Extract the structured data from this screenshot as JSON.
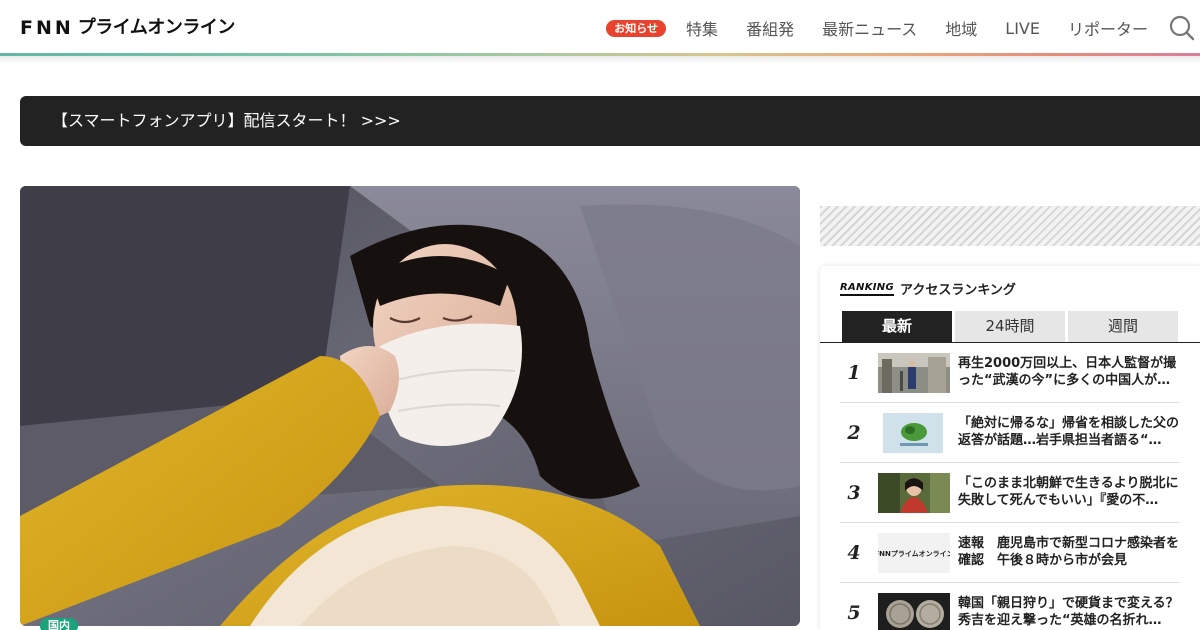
{
  "header": {
    "logo_fnn": [
      "F",
      "N",
      "N"
    ],
    "logo_jp": "プライムオンライン",
    "badge": "お知らせ",
    "nav": [
      "特集",
      "番組発",
      "最新ニュース",
      "地域",
      "LIVE",
      "リポーター"
    ],
    "search_icon": "search-icon"
  },
  "banner": {
    "text": "【スマートフォンアプリ】配信スタート！ >>>"
  },
  "hero": {
    "tag": "国内"
  },
  "ranking": {
    "logo": "RANKING",
    "title": "アクセスランキング",
    "tabs": [
      "最新",
      "24時間",
      "週間"
    ],
    "active_tab": "最新",
    "items": [
      {
        "num": "1",
        "text": "再生2000万回以上、日本人監督が撮った“武漢の今”に多くの中国人が…"
      },
      {
        "num": "2",
        "text": "「絶対に帰るな」帰省を相談した父の返答が話題…岩手県担当者語る“…"
      },
      {
        "num": "3",
        "text": "「このまま北朝鮮で生きるより脱北に失敗して死んでもいい」『愛の不…"
      },
      {
        "num": "4",
        "text": "速報　鹿児島市で新型コロナ感染者を確認　午後８時から市が会見",
        "thumb_text": "FNNプライムオンライン"
      },
      {
        "num": "5",
        "text": "韓国「親日狩り」で硬貨まで変える？秀吉を迎え撃った“英雄の名折れ…"
      }
    ]
  },
  "colors": {
    "badge": "#e8432f",
    "banner_bg": "#222222",
    "tag": "#1aa37a",
    "tab_active": "#222222",
    "tab_inactive": "#e6e6e6"
  }
}
